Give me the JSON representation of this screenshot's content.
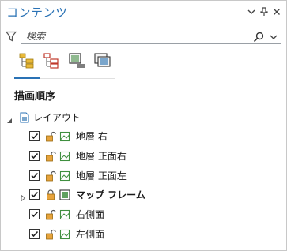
{
  "pane": {
    "title": "コンテンツ",
    "icons": [
      "chevron-down-icon",
      "pin-icon",
      "close-icon"
    ]
  },
  "search": {
    "placeholder": "検索",
    "value": ""
  },
  "views": [
    {
      "name": "drawing-order-view",
      "active": true
    },
    {
      "name": "selection-view",
      "active": false
    },
    {
      "name": "editing-view",
      "active": false
    },
    {
      "name": "snapping-view",
      "active": false
    }
  ],
  "section": {
    "title": "描画順序"
  },
  "tree": {
    "root": {
      "label": "レイアウト",
      "expanded": true
    },
    "items": [
      {
        "label": "地層 右",
        "checked": true,
        "bold": false,
        "type": "map-frame"
      },
      {
        "label": "地層 正面右",
        "checked": true,
        "bold": false,
        "type": "map-frame"
      },
      {
        "label": "地層 正面左",
        "checked": true,
        "bold": false,
        "type": "map-frame"
      },
      {
        "label": "マップ フレーム",
        "checked": true,
        "bold": true,
        "type": "map-frame-active",
        "expandable": true
      },
      {
        "label": "右側面",
        "checked": true,
        "bold": false,
        "type": "map-frame"
      },
      {
        "label": "左側面",
        "checked": true,
        "bold": false,
        "type": "map-frame"
      }
    ]
  },
  "colors": {
    "accent": "#2a72b5",
    "lock": "#d08a2a",
    "frame": "#3f8f3f"
  }
}
